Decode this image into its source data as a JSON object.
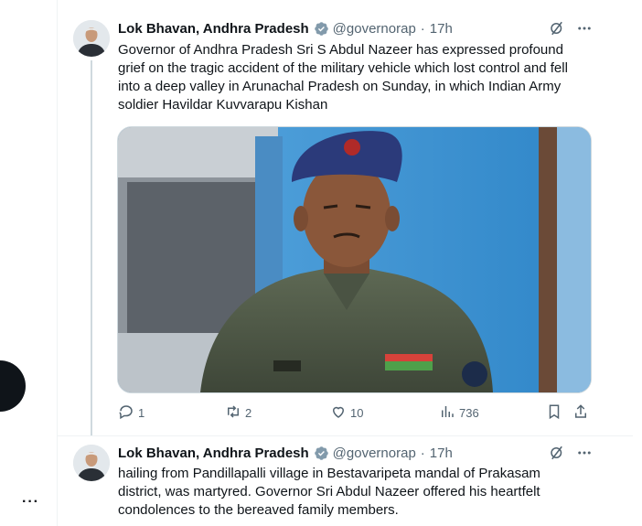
{
  "colors": {
    "text": "#0f1419",
    "muted": "#536471",
    "verified": "#829aab",
    "line": "#cfd9de"
  },
  "tweet1": {
    "author_name": "Lok Bhavan, Andhra Pradesh",
    "handle": "@governorap",
    "separator": "·",
    "time": "17h",
    "text": "Governor of Andhra Pradesh Sri S Abdul Nazeer has expressed profound grief on the tragic accident of the military vehicle which lost control and fell into a deep valley in Arunachal Pradesh on Sunday, in which Indian Army soldier Havildar Kuvvarapu Kishan",
    "replies": "1",
    "reposts": "2",
    "likes": "10",
    "views": "736"
  },
  "tweet2": {
    "author_name": "Lok Bhavan, Andhra Pradesh",
    "handle": "@governorap",
    "separator": "·",
    "time": "17h",
    "text": "hailing from Pandillapalli village in Bestavaripeta mandal of Prakasam district, was martyred. Governor Sri Abdul Nazeer offered his heartfelt condolences to the bereaved family members."
  },
  "left_rail": {
    "more_label": "···"
  },
  "icons": [
    "verified-badge-icon",
    "grok-icon",
    "more-icon",
    "reply-icon",
    "repost-icon",
    "like-icon",
    "views-icon",
    "bookmark-icon",
    "share-icon"
  ]
}
